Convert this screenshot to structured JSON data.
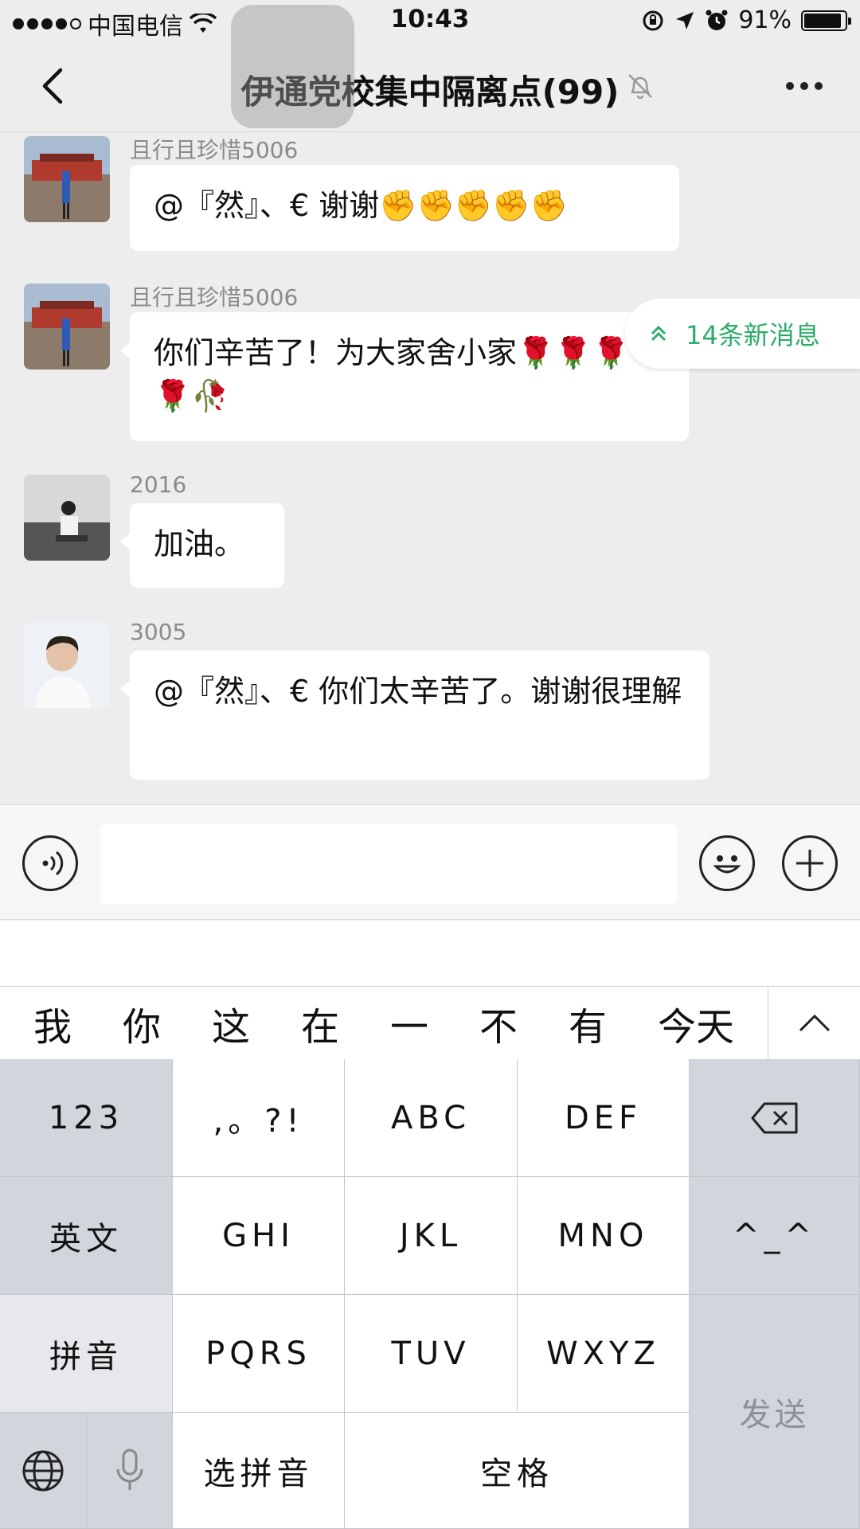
{
  "status_bar": {
    "carrier": "中国电信",
    "time": "10:43",
    "battery": "91%",
    "battery_level": 0.91
  },
  "nav": {
    "title": "伊通党校集中隔离点(99)"
  },
  "messages": [
    {
      "sender": "且行且珍惜5006",
      "text": "@『然』、€ 谢谢✊✊✊✊✊"
    },
    {
      "sender": "且行且珍惜5006",
      "text": "你们辛苦了！为大家舍小家🌹🌹🌹🌹🥀"
    },
    {
      "sender": "2016",
      "text": "加油。"
    },
    {
      "sender": "3005",
      "text": "@『然』、€ 你们太辛苦了。谢谢很理解"
    }
  ],
  "new_messages": {
    "label": "14条新消息"
  },
  "candidates": [
    "我",
    "你",
    "这",
    "在",
    "一",
    "不",
    "有",
    "今天"
  ],
  "keyboard": {
    "row1": [
      "123",
      ",。?!",
      "ABC",
      "DEF"
    ],
    "row2": [
      "英文",
      "GHI",
      "JKL",
      "MNO",
      "^_^"
    ],
    "row3": [
      "拼音",
      "PQRS",
      "TUV",
      "WXYZ"
    ],
    "row4": [
      "选拼音",
      "空格"
    ],
    "send": "发送"
  }
}
